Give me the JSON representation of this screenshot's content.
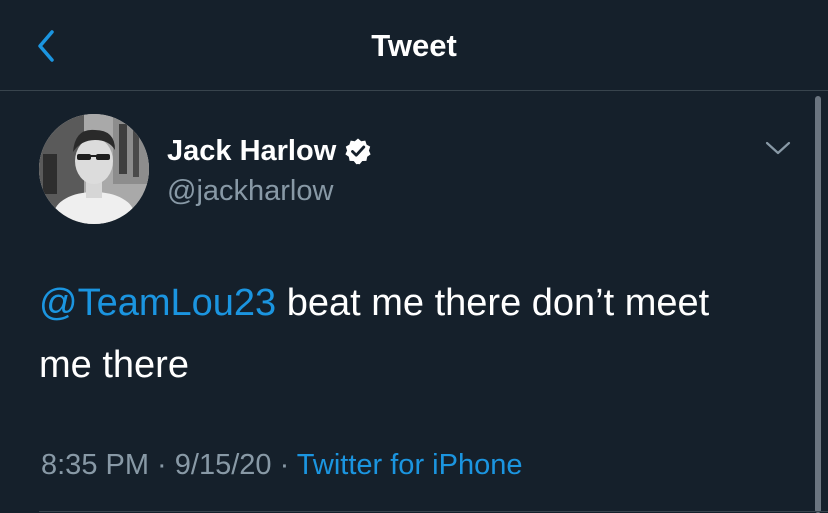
{
  "header": {
    "title": "Tweet",
    "back_icon": "chevron-left-icon"
  },
  "author": {
    "display_name": "Jack Harlow",
    "handle": "@jackharlow",
    "verified": true,
    "avatar_icon": "avatar-photo"
  },
  "tweet": {
    "mention": "@TeamLou23",
    "text": " beat me there don’t meet me there"
  },
  "meta": {
    "time": "8:35 PM",
    "separator1": " · ",
    "date": "9/15/20",
    "separator2": " · ",
    "source": "Twitter for iPhone"
  },
  "colors": {
    "background": "#15202b",
    "accent": "#1b95e0",
    "secondary_text": "#8899a6",
    "divider": "#38444d"
  },
  "menu": {
    "icon": "chevron-down-icon"
  }
}
